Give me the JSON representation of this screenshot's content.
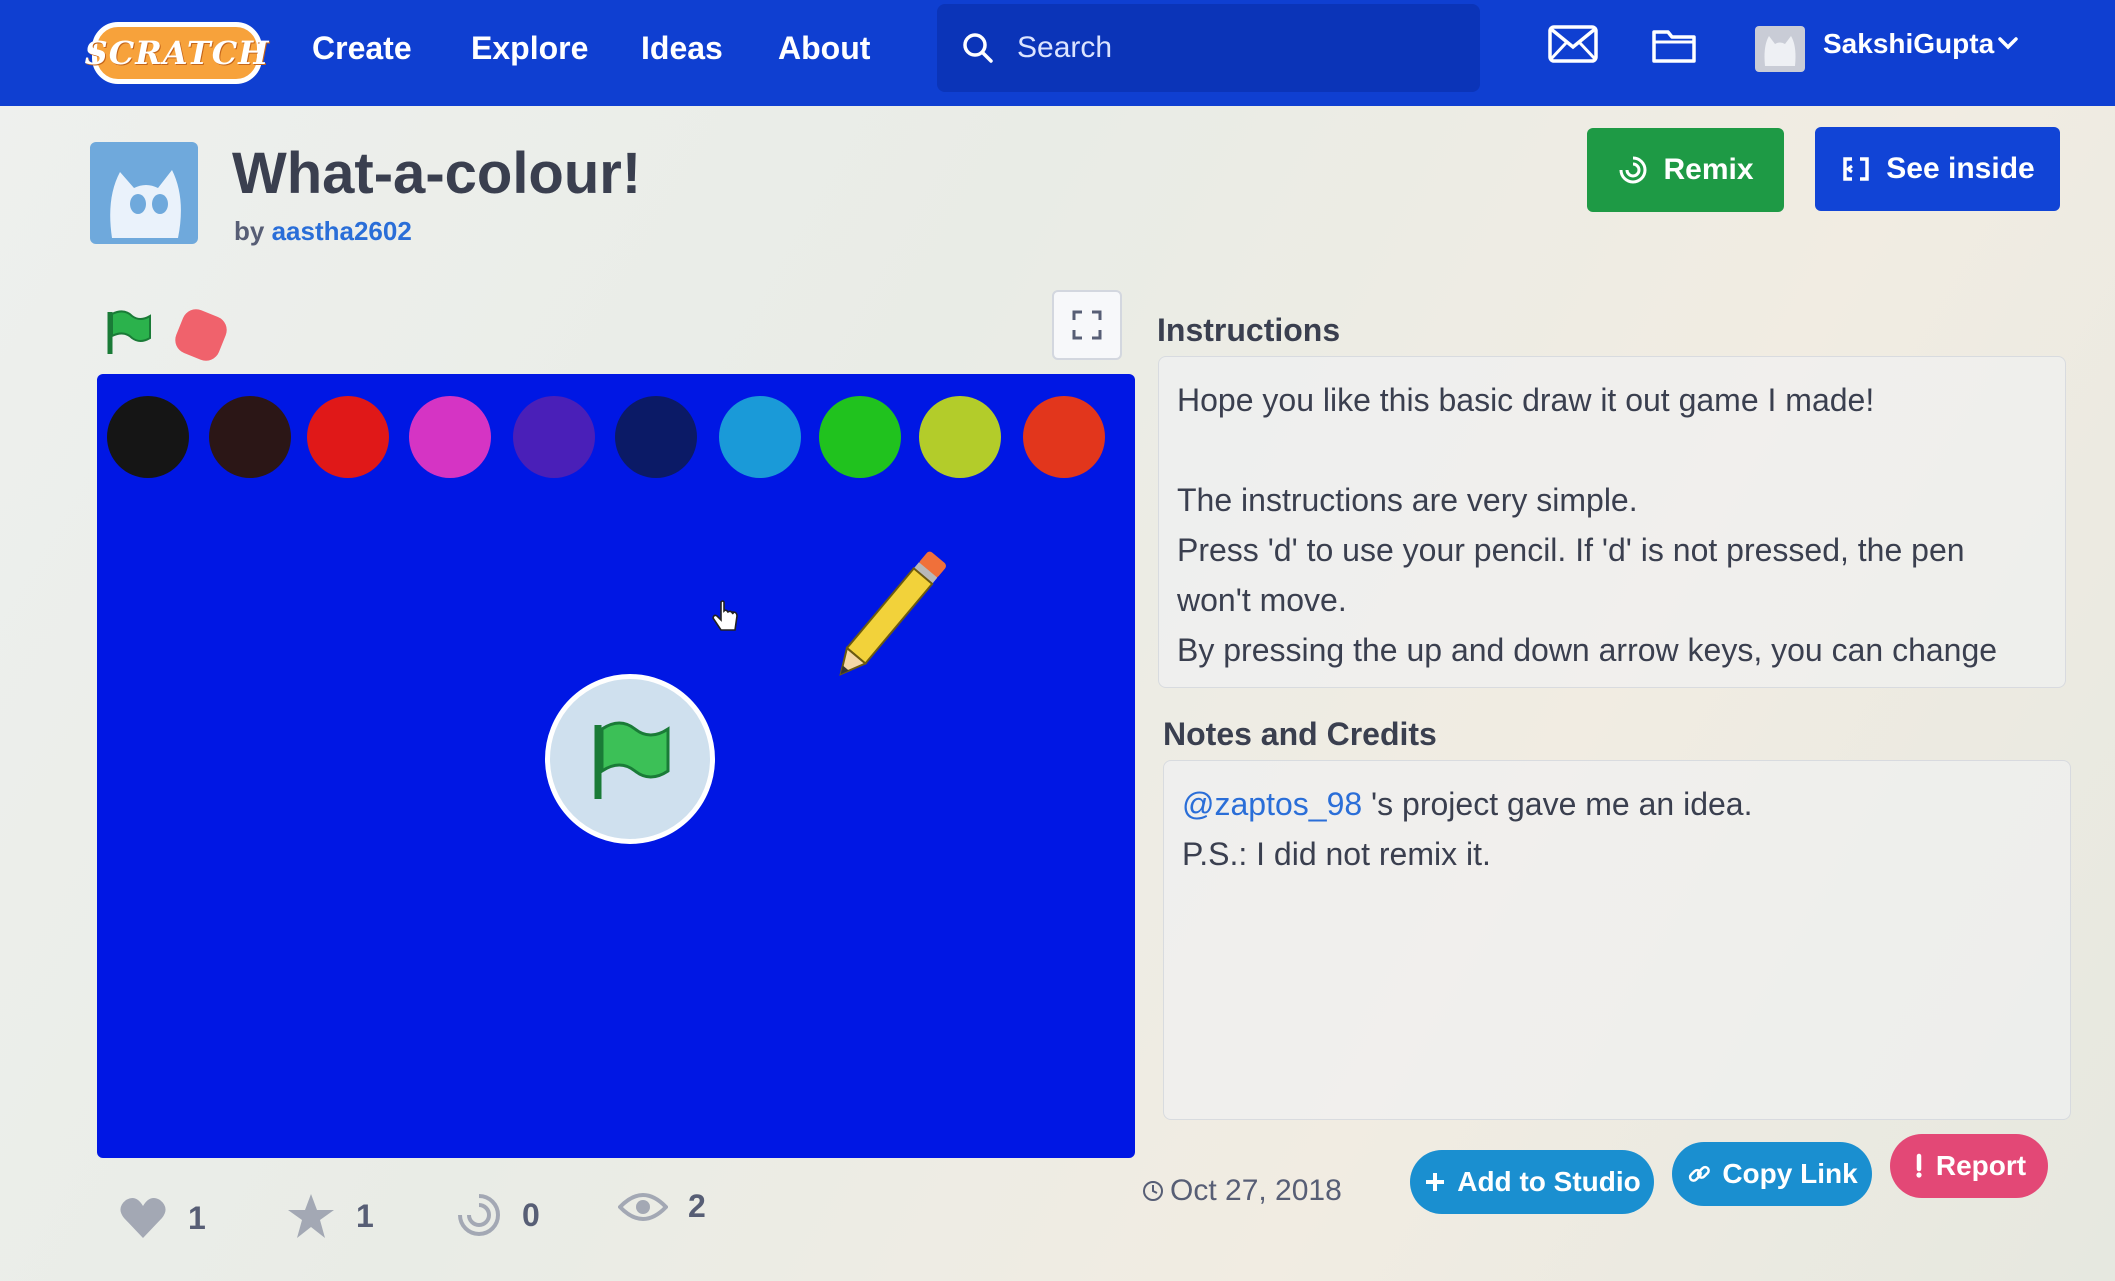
{
  "navbar": {
    "logo_text": "SCRATCH",
    "links": [
      "Create",
      "Explore",
      "Ideas",
      "About"
    ],
    "search_placeholder": "Search",
    "username": "SakshiGupta",
    "icons": [
      "messages-icon",
      "my-stuff-folder-icon",
      "user-avatar",
      "chevron-down-icon"
    ]
  },
  "project": {
    "title": "What-a-colour!",
    "by_label": "by",
    "author": "aastha2602",
    "remix_label": "Remix",
    "see_inside_label": "See inside"
  },
  "stage": {
    "background_color": "#0017e4",
    "palette_colors": [
      "#151515",
      "#2b1616",
      "#e01818",
      "#d534c4",
      "#4a1fb8",
      "#0b1a66",
      "#1a9ad8",
      "#20c21e",
      "#b3cc2a",
      "#e2361c"
    ]
  },
  "stats": {
    "loves": "1",
    "favorites": "1",
    "remixes": "0",
    "views": "2"
  },
  "instructions": {
    "heading": "Instructions",
    "lines": [
      "Hope you like this basic draw it out game I made!",
      "",
      "The instructions are very simple.",
      "Press 'd' to use your pencil. If 'd' is not pressed, the pen",
      "won't move.",
      "By pressing the up and down arrow keys, you can change"
    ]
  },
  "notes": {
    "heading": "Notes and Credits",
    "mention": "@zaptos_98",
    "line1_rest": " 's project gave me an idea.",
    "line2": "P.S.: I did not remix it."
  },
  "footer": {
    "date": "Oct 27, 2018",
    "add_to_studio_label": "Add to Studio",
    "copy_link_label": "Copy Link",
    "report_label": "Report"
  },
  "colors": {
    "navbar": "#0f3fd1",
    "remix": "#1e9a45",
    "see_inside": "#1144d6",
    "link": "#2a6ed8",
    "report": "#e34876"
  }
}
